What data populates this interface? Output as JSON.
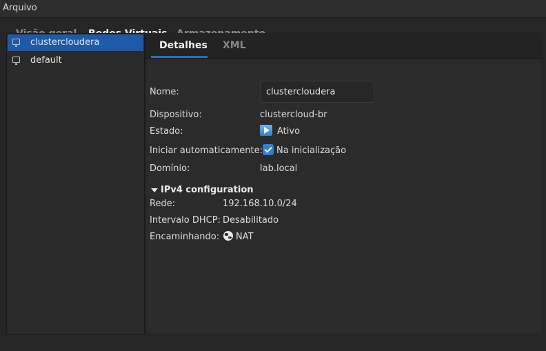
{
  "menubar": {
    "file": "Arquivo"
  },
  "tabs": [
    {
      "label": "Visão geral",
      "active": false
    },
    {
      "label": "Redes Virtuais",
      "active": true
    },
    {
      "label": "Armazenamento",
      "active": false
    }
  ],
  "networks": [
    {
      "name": "clustercloudera",
      "selected": true
    },
    {
      "name": "default",
      "selected": false
    }
  ],
  "subtabs": [
    {
      "label": "Detalhes",
      "active": true
    },
    {
      "label": "XML",
      "active": false
    }
  ],
  "details": {
    "name_label": "Nome:",
    "name_value": "clustercloudera",
    "device_label": "Dispositivo:",
    "device_value": "clustercloud-br",
    "state_label": "Estado:",
    "state_value": "Ativo",
    "autostart_label": "Iniciar automaticamente:",
    "autostart_value": "Na inicialização",
    "autostart_checked": true,
    "domain_label": "Domínio:",
    "domain_value": "lab.local"
  },
  "ipv4": {
    "title": "IPv4 configuration",
    "network_label": "Rede:",
    "network_value": "192.168.10.0/24",
    "dhcp_label": "Intervalo DHCP:",
    "dhcp_value": "Desabilitado",
    "forward_label": "Encaminhando:",
    "forward_value": "NAT"
  },
  "colors": {
    "accent": "#2f6fbd",
    "selection": "#1e5aa8",
    "background": "#2b2b2b"
  },
  "icons": {
    "network": "network-icon",
    "state": "play-icon",
    "autostart": "checkbox-checked-icon",
    "forward": "globe-icon",
    "expander": "triangle-down-icon"
  }
}
